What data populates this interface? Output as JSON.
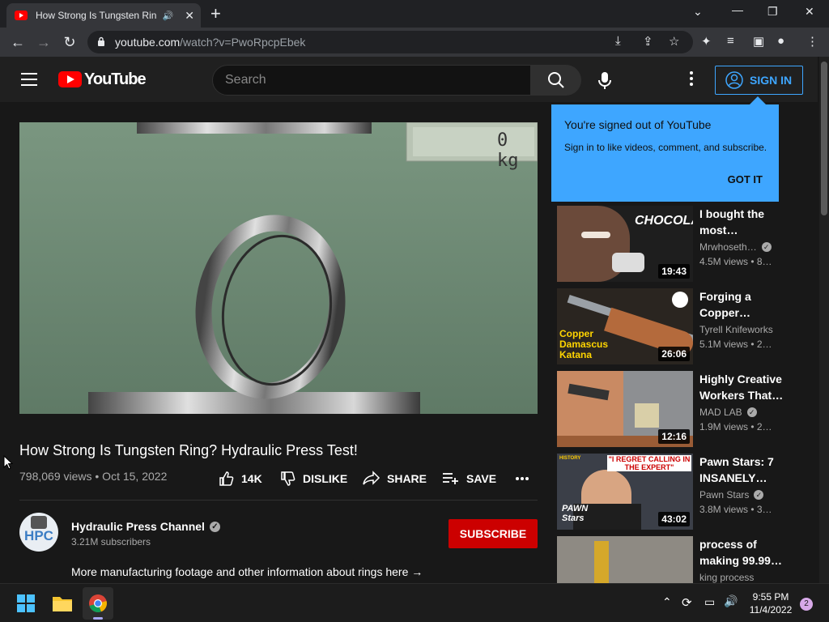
{
  "browser": {
    "tab_title": "How Strong Is Tungsten Ring? Hydraulic Press Test!",
    "url_host": "youtube.com",
    "url_path": "/watch?v=PwoRpcpEbek"
  },
  "youtube": {
    "logo_text": "YouTube",
    "search_placeholder": "Search",
    "sign_in_label": "SIGN IN"
  },
  "popup": {
    "title": "You're signed out of YouTube",
    "body": "Sign in to like videos, comment, and subscribe.",
    "button": "GOT IT"
  },
  "video": {
    "scale_readout": "0 kg",
    "title": "How Strong Is Tungsten Ring? Hydraulic Press Test!",
    "meta": "798,069 views • Oct 15, 2022",
    "like_count": "14K",
    "dislike_label": "DISLIKE",
    "share_label": "SHARE",
    "save_label": "SAVE",
    "channel_name": "Hydraulic Press Channel",
    "channel_avatar_text": "HPC",
    "subscribers": "3.21M subscribers",
    "subscribe_label": "SUBSCRIBE",
    "description": "More manufacturing footage and other information about rings here →"
  },
  "related": [
    {
      "title": "I bought the most…",
      "channel": "Mrwhoseth…",
      "verified": true,
      "views": "4.5M views • 8…",
      "duration": "19:43",
      "thumb_text": "CHOCOLATE"
    },
    {
      "title": "Forging a Copper…",
      "channel": "Tyrell Knifeworks",
      "verified": false,
      "views": "5.1M views • 2…",
      "duration": "26:06",
      "thumb_text": "Copper Damascus Katana"
    },
    {
      "title": "Highly Creative Workers That…",
      "channel": "MAD LAB",
      "verified": true,
      "views": "1.9M views • 2…",
      "duration": "12:16",
      "thumb_text": ""
    },
    {
      "title": "Pawn Stars: 7 INSANELY…",
      "channel": "Pawn Stars",
      "verified": true,
      "views": "3.8M views • 3…",
      "duration": "43:02",
      "thumb_text": "\"I REGRET CALLING IN THE EXPERT\"",
      "thumb_logo": "PAWN Stars",
      "thumb_badge": "HISTORY"
    },
    {
      "title": "process of making 99.99…",
      "channel": "king process",
      "verified": false,
      "views": "",
      "duration": "",
      "thumb_text": ""
    }
  ],
  "taskbar": {
    "time": "9:55 PM",
    "date": "11/4/2022",
    "notifications": "2"
  }
}
